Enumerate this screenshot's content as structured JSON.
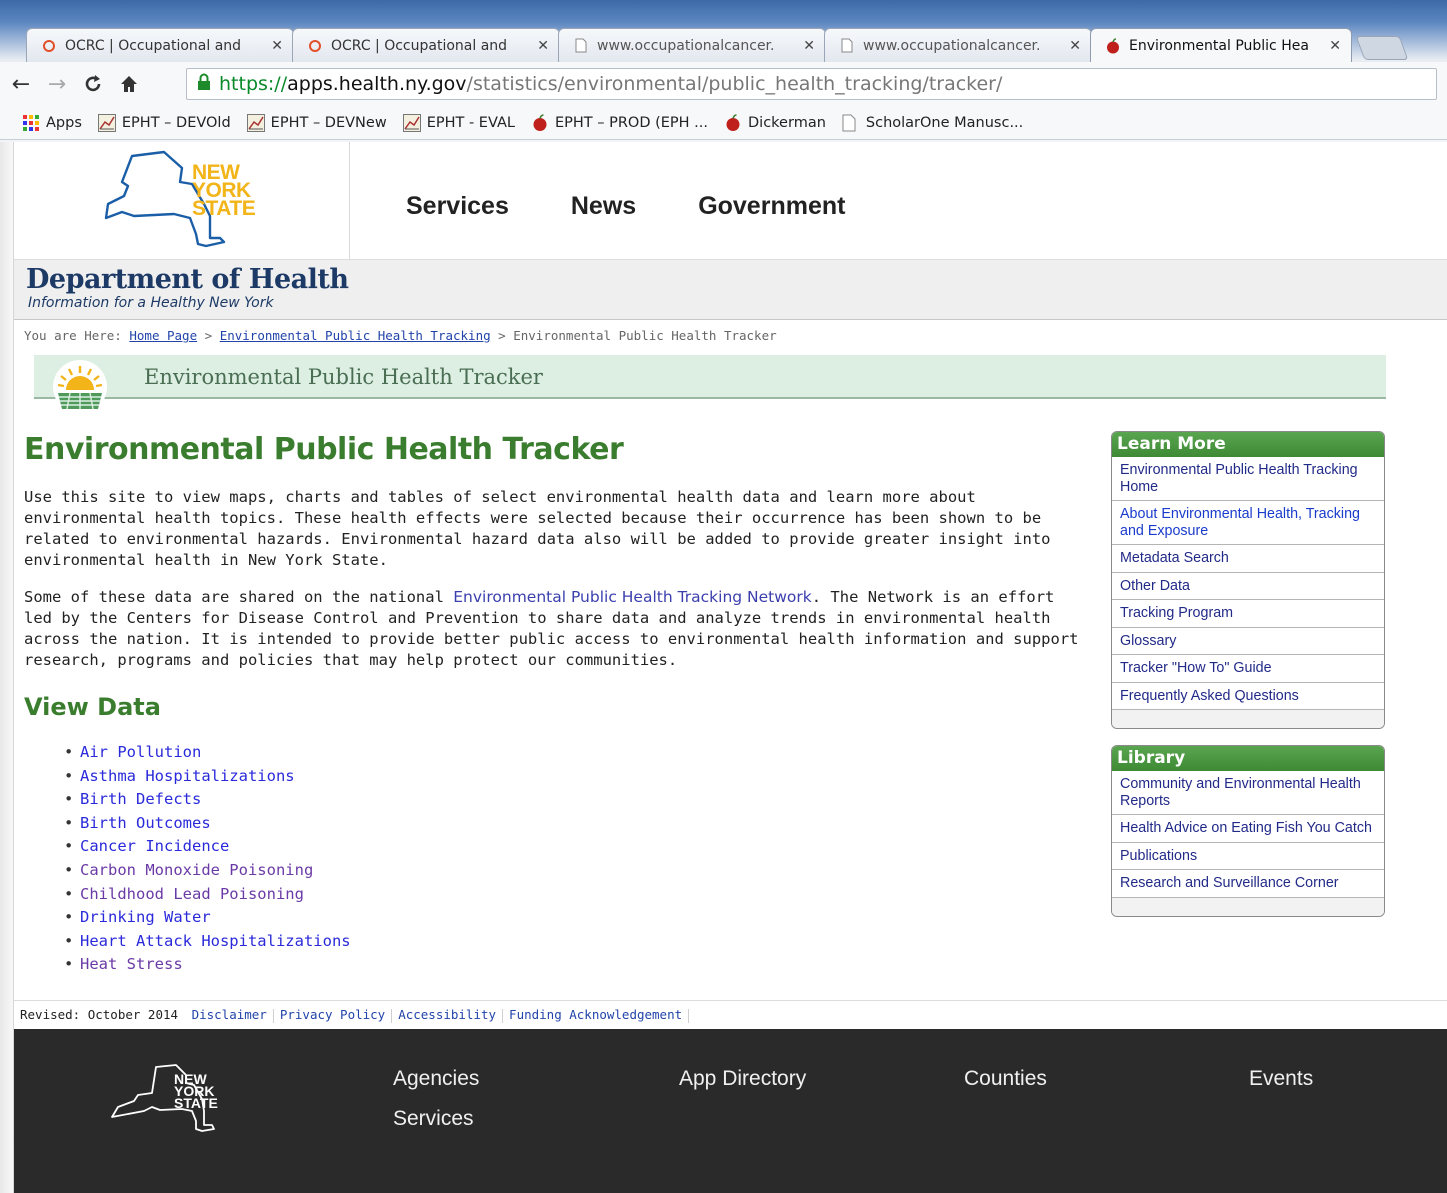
{
  "browser": {
    "tabs": [
      {
        "title": "OCRC | Occupational and",
        "icon": "ring-icon"
      },
      {
        "title": "OCRC | Occupational and",
        "icon": "ring-icon"
      },
      {
        "title": "www.occupationalcancer.",
        "icon": "page-icon"
      },
      {
        "title": "www.occupationalcancer.",
        "icon": "page-icon"
      },
      {
        "title": "Environmental Public Hea",
        "icon": "apple-icon"
      }
    ],
    "url": {
      "scheme": "https://",
      "host": "apps.health.ny.gov",
      "path": "/statistics/environmental/public_health_tracking/tracker/"
    },
    "bookmarks": [
      {
        "label": "Apps",
        "icon": "apps-grid-icon"
      },
      {
        "label": "EPHT – DEVOld",
        "icon": "chart-icon"
      },
      {
        "label": "EPHT – DEVNew",
        "icon": "chart-icon"
      },
      {
        "label": "EPHT - EVAL",
        "icon": "chart-icon"
      },
      {
        "label": "EPHT – PROD (EPH ...",
        "icon": "apple-icon"
      },
      {
        "label": "Dickerman",
        "icon": "apple-icon"
      },
      {
        "label": "ScholarOne Manusc...",
        "icon": "page-icon"
      }
    ]
  },
  "header": {
    "logo_text": [
      "NEW",
      "YORK",
      "STATE"
    ],
    "nav": [
      "Services",
      "News",
      "Government"
    ],
    "department": "Department of Health",
    "tagline": "Information for a Healthy New York"
  },
  "breadcrumb": {
    "prefix": "You are Here:",
    "home": "Home Page",
    "sep": ">",
    "section": "Environmental Public Health Tracking",
    "current": "Environmental Public Health Tracker"
  },
  "program_banner": "Environmental Public Health Tracker",
  "main": {
    "title": "Environmental Public Health Tracker",
    "para1": "Use this site to view maps, charts and tables of select environmental health data and learn more about environmental health topics. These health effects were selected because their occurrence has been shown to be related to environmental hazards. Environmental hazard data also will be added to provide greater insight into environmental health in New York State.",
    "para2_before": "Some of these data are shared on the national ",
    "para2_link": "Environmental Public Health Tracking Network",
    "para2_after": ". The Network is an effort led by the Centers for Disease Control and Prevention to share data and analyze trends in environmental health across the nation. It is intended to provide better public access to environmental health information and support research, programs and policies that may help protect our communities.",
    "view_data_title": "View Data",
    "view_data_items": [
      "Air Pollution",
      "Asthma Hospitalizations",
      "Birth Defects",
      "Birth Outcomes",
      "Cancer Incidence",
      "Carbon Monoxide Poisoning",
      "Childhood Lead Poisoning",
      "Drinking Water",
      "Heart Attack Hospitalizations",
      "Heat Stress"
    ]
  },
  "learn_more": {
    "title": "Learn More",
    "items": [
      "Environmental Public Health Tracking Home",
      "About Environmental Health, Tracking and Exposure",
      "Metadata Search",
      "Other Data",
      "Tracking Program",
      "Glossary",
      "Tracker \"How To\" Guide",
      "Frequently Asked Questions"
    ]
  },
  "library": {
    "title": "Library",
    "items": [
      "Community and Environmental Health Reports",
      "Health Advice on Eating Fish You Catch",
      "Publications",
      "Research and Surveillance Corner"
    ]
  },
  "footer_links": {
    "revised": "Revised: October 2014",
    "links": [
      "Disclaimer",
      "Privacy Policy",
      "Accessibility",
      "Funding Acknowledgement"
    ]
  },
  "footer_nav": [
    "Agencies",
    "Services",
    "App Directory",
    "Counties",
    "Events"
  ],
  "colors": {
    "heading_green": "#3a7d2e",
    "footer_bg": "#2a2a2a",
    "doh_navy": "#1d3a66",
    "logo_yellow": "#f2b418",
    "logo_blue": "#1b5ea8"
  }
}
